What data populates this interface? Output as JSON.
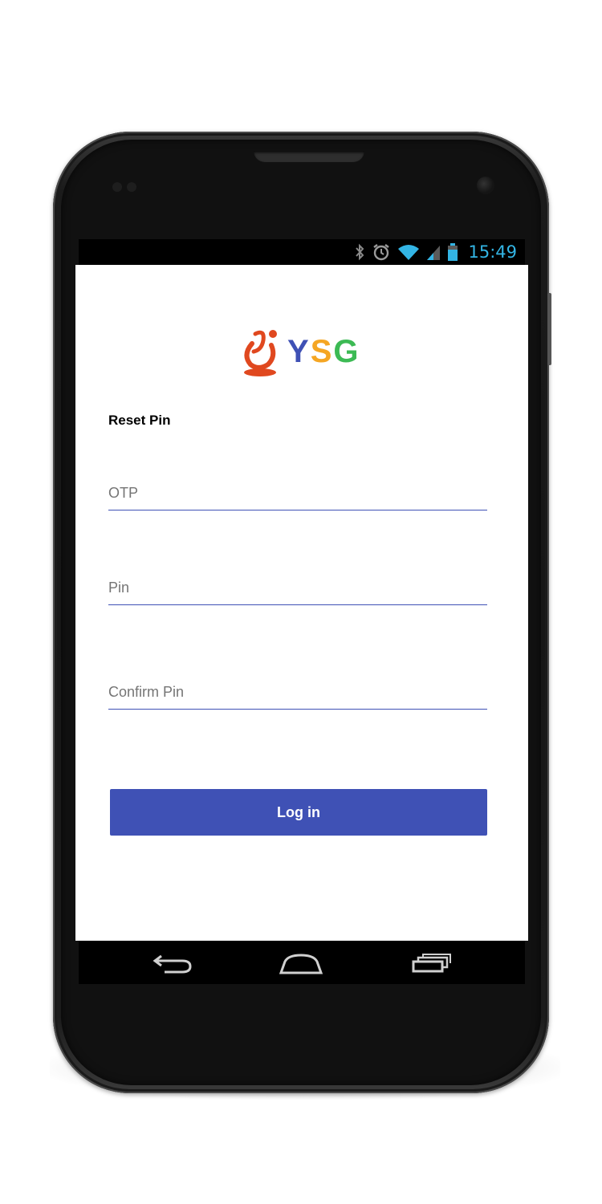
{
  "status_bar": {
    "time": "15:49",
    "icons": [
      "bluetooth-icon",
      "alarm-icon",
      "wifi-icon",
      "signal-icon",
      "battery-icon"
    ],
    "icon_color": "#33b5e5"
  },
  "logo": {
    "letters": [
      "Y",
      "S",
      "G"
    ],
    "colors": {
      "mark": "#e0481f",
      "y": "#3f51b5",
      "s": "#f5a623",
      "g": "#3cba54"
    }
  },
  "form": {
    "title": "Reset Pin",
    "otp_placeholder": "OTP",
    "pin_placeholder": "Pin",
    "confirm_pin_placeholder": "Confirm Pin",
    "submit_label": "Log in"
  },
  "theme": {
    "accent": "#3f51b5"
  },
  "nav_bar": {
    "buttons": [
      "back-icon",
      "home-icon",
      "recent-apps-icon"
    ]
  }
}
